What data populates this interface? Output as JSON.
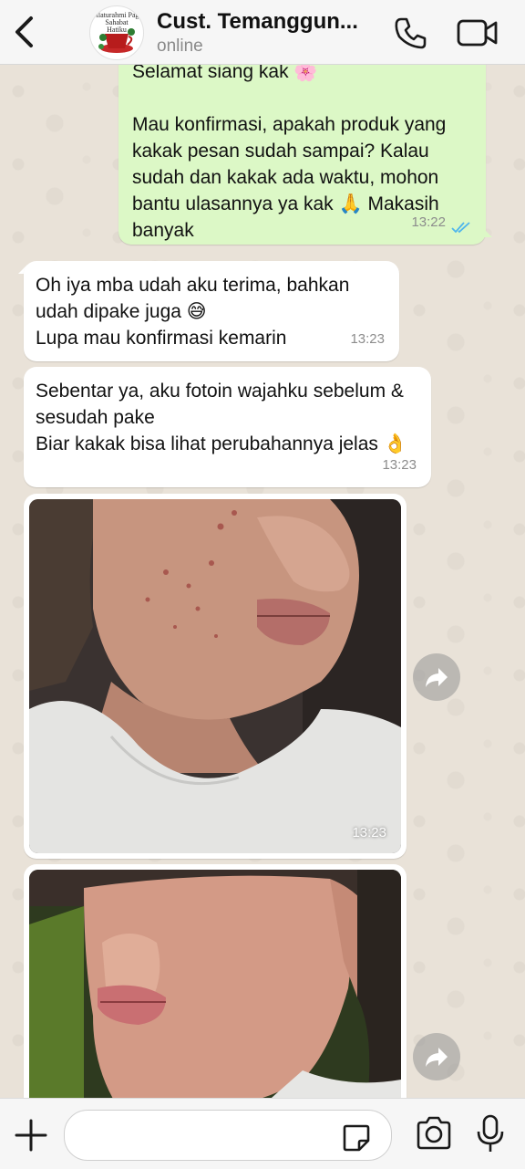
{
  "header": {
    "contact_name": "Cust. Temanggun...",
    "status": "online",
    "avatar_text": [
      "Silaturahmi Pagi",
      "Sahabat",
      "Hatiku"
    ]
  },
  "messages": [
    {
      "direction": "outgoing",
      "text": "Selamat siang kak 🌸\n\nMau konfirmasi, apakah produk yang kakak pesan sudah sampai? Kalau sudah dan kakak ada waktu, mohon bantu ulasannya ya kak 🙏 Makasih banyak",
      "time": "13:22",
      "status": "read"
    },
    {
      "direction": "incoming",
      "text": "Oh iya mba udah aku terima, bahkan udah dipake juga 😅\nLupa mau konfirmasi kemarin",
      "time": "13:23"
    },
    {
      "direction": "incoming",
      "text": "Sebentar ya, aku fotoin wajahku sebelum & sesudah pake\nBiar kakak bisa lihat perubahannya jelas 👌",
      "time": "13:23"
    },
    {
      "direction": "incoming",
      "type": "photo",
      "time": "13:23"
    },
    {
      "direction": "incoming",
      "type": "photo",
      "time": ""
    }
  ],
  "composer": {
    "placeholder": ""
  },
  "colors": {
    "outgoing_bubble": "#dcf8c6",
    "incoming_bubble": "#ffffff",
    "read_ticks": "#4fb6ec",
    "icon": "#1a1a1a"
  },
  "icons": [
    "back-arrow-icon",
    "phone-icon",
    "video-camera-icon",
    "forward-icon",
    "plus-icon",
    "sticker-icon",
    "camera-icon",
    "microphone-icon"
  ]
}
